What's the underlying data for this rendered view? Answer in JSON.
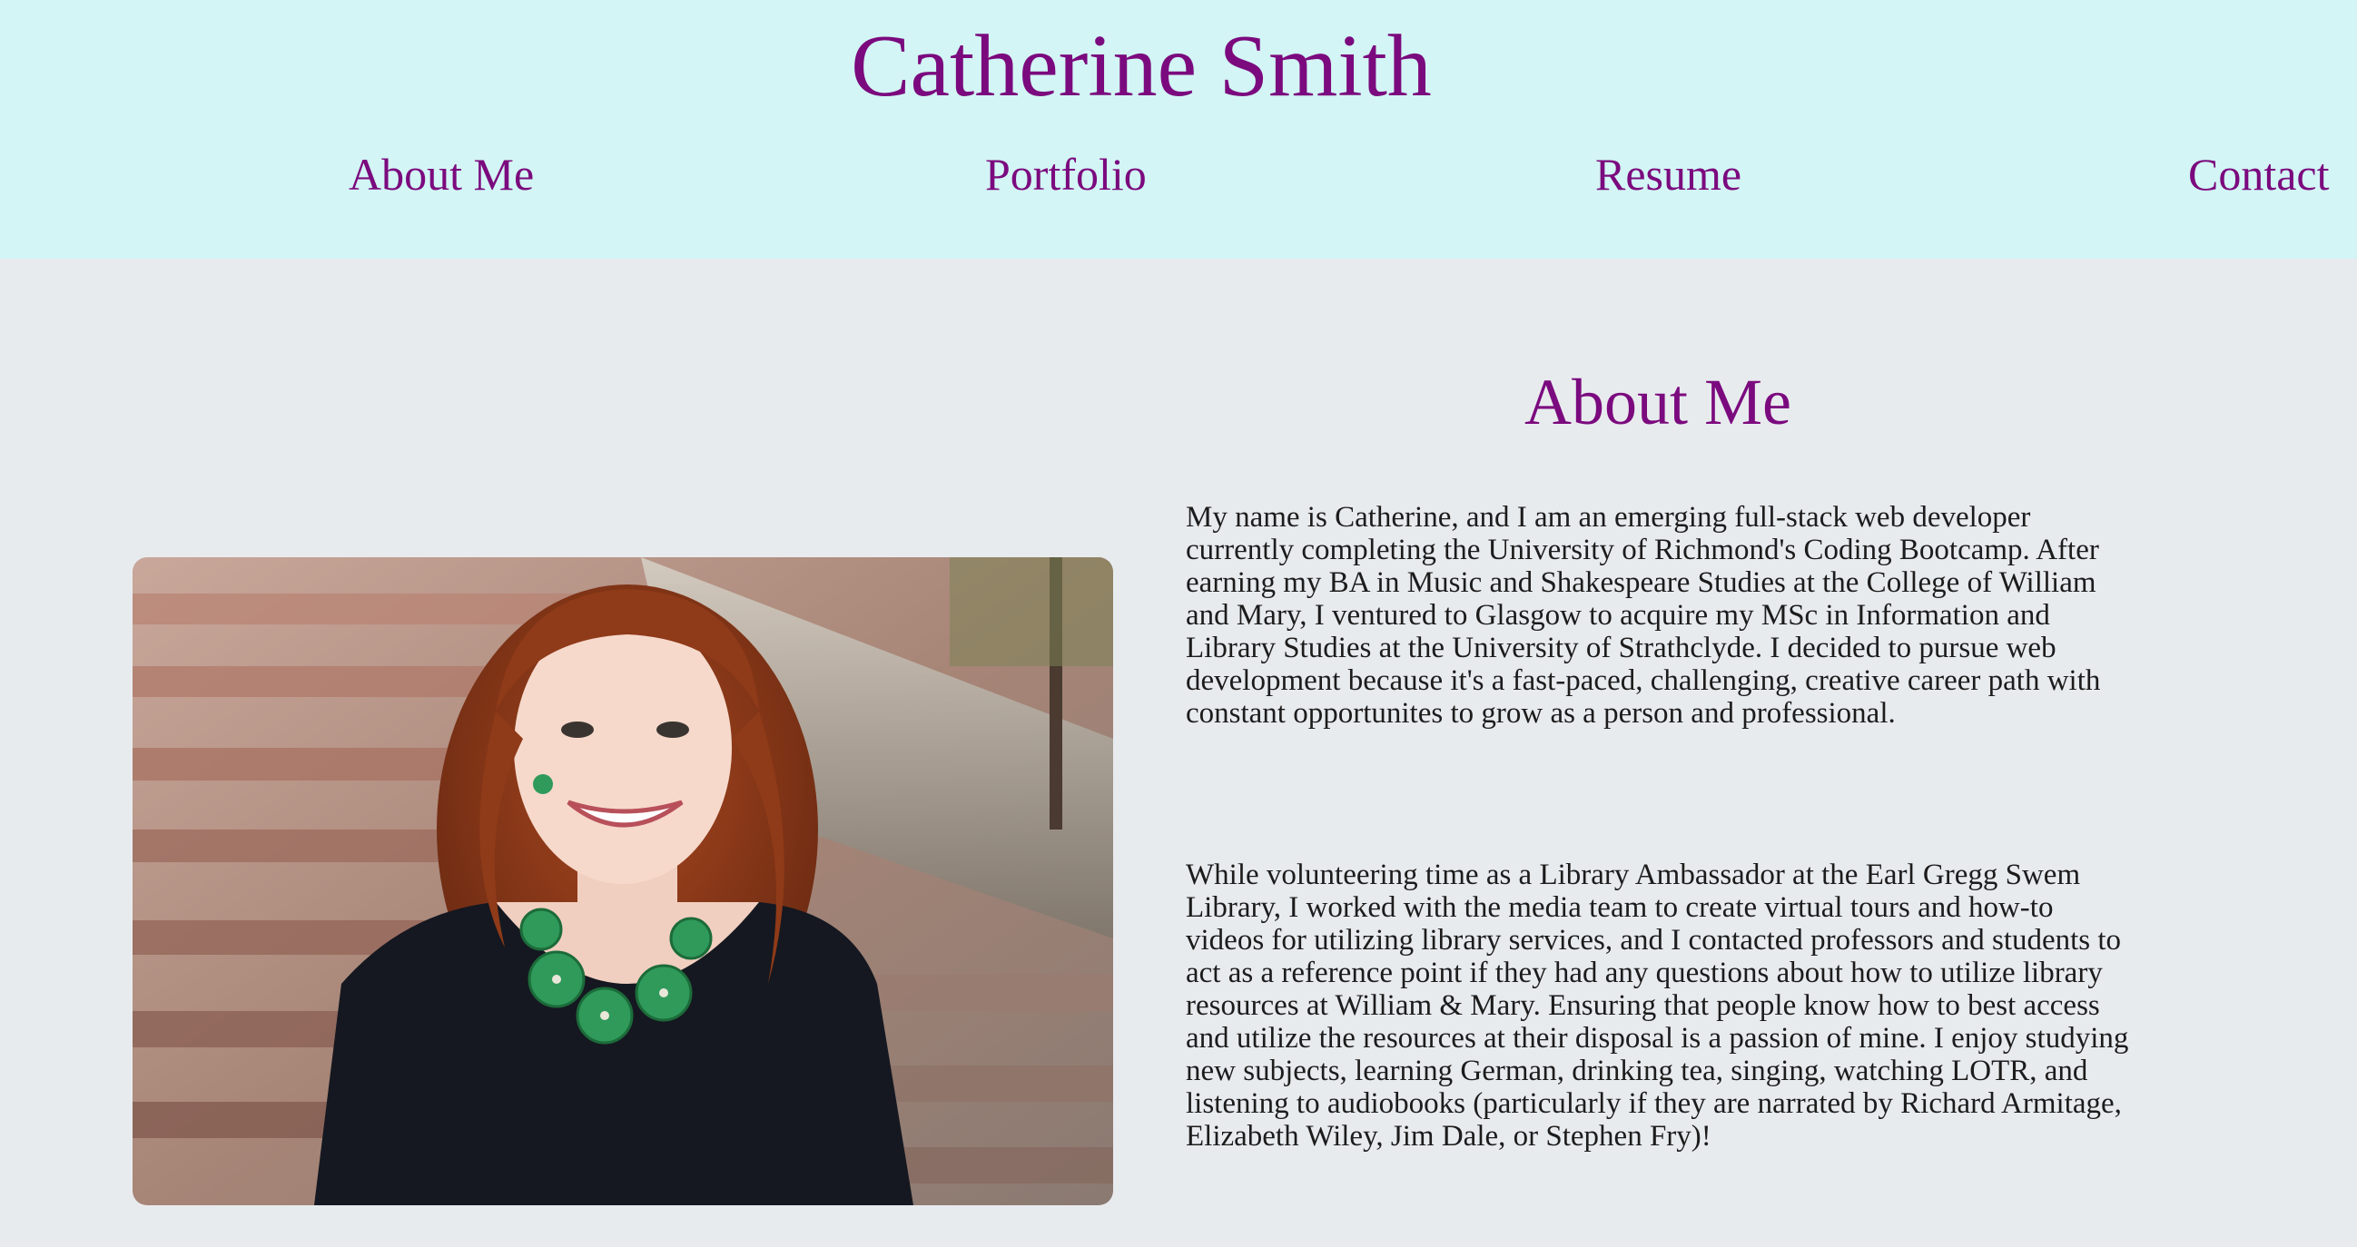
{
  "header": {
    "title": "Catherine Smith",
    "nav": [
      {
        "label": "About Me"
      },
      {
        "label": "Portfolio"
      },
      {
        "label": "Resume"
      },
      {
        "label": "Contact"
      }
    ],
    "background": "#d3f5f5",
    "accent": "#7b0a7e"
  },
  "about": {
    "heading": "About Me",
    "photo_alt": "portrait-photo",
    "paragraphs": [
      "My name is Catherine, and I am an emerging full-stack web developer currently completing the University of Richmond's Coding Bootcamp. After earning my BA in Music and Shakespeare Studies at the College of William and Mary, I ventured to Glasgow to acquire my MSc in Information and Library Studies at the University of Strathclyde. I decided to pursue web development because it's a fast-paced, challenging, creative career path with constant opportunites to grow as a person and professional.",
      "While volunteering time as a Library Ambassador at the Earl Gregg Swem Library, I worked with the media team to create virtual tours and how-to videos for utilizing library services, and I contacted professors and students to act as a reference point if they had any questions about how to utilize library resources at William & Mary. Ensuring that people know how to best access and utilize the resources at their disposal is a passion of mine. I enjoy studying new subjects, learning German, drinking tea, singing, watching LOTR, and listening to audiobooks (particularly if they are narrated by Richard Armitage, Elizabeth Wiley, Jim Dale, or Stephen Fry)!"
    ]
  },
  "page_background": "#e8ebee"
}
